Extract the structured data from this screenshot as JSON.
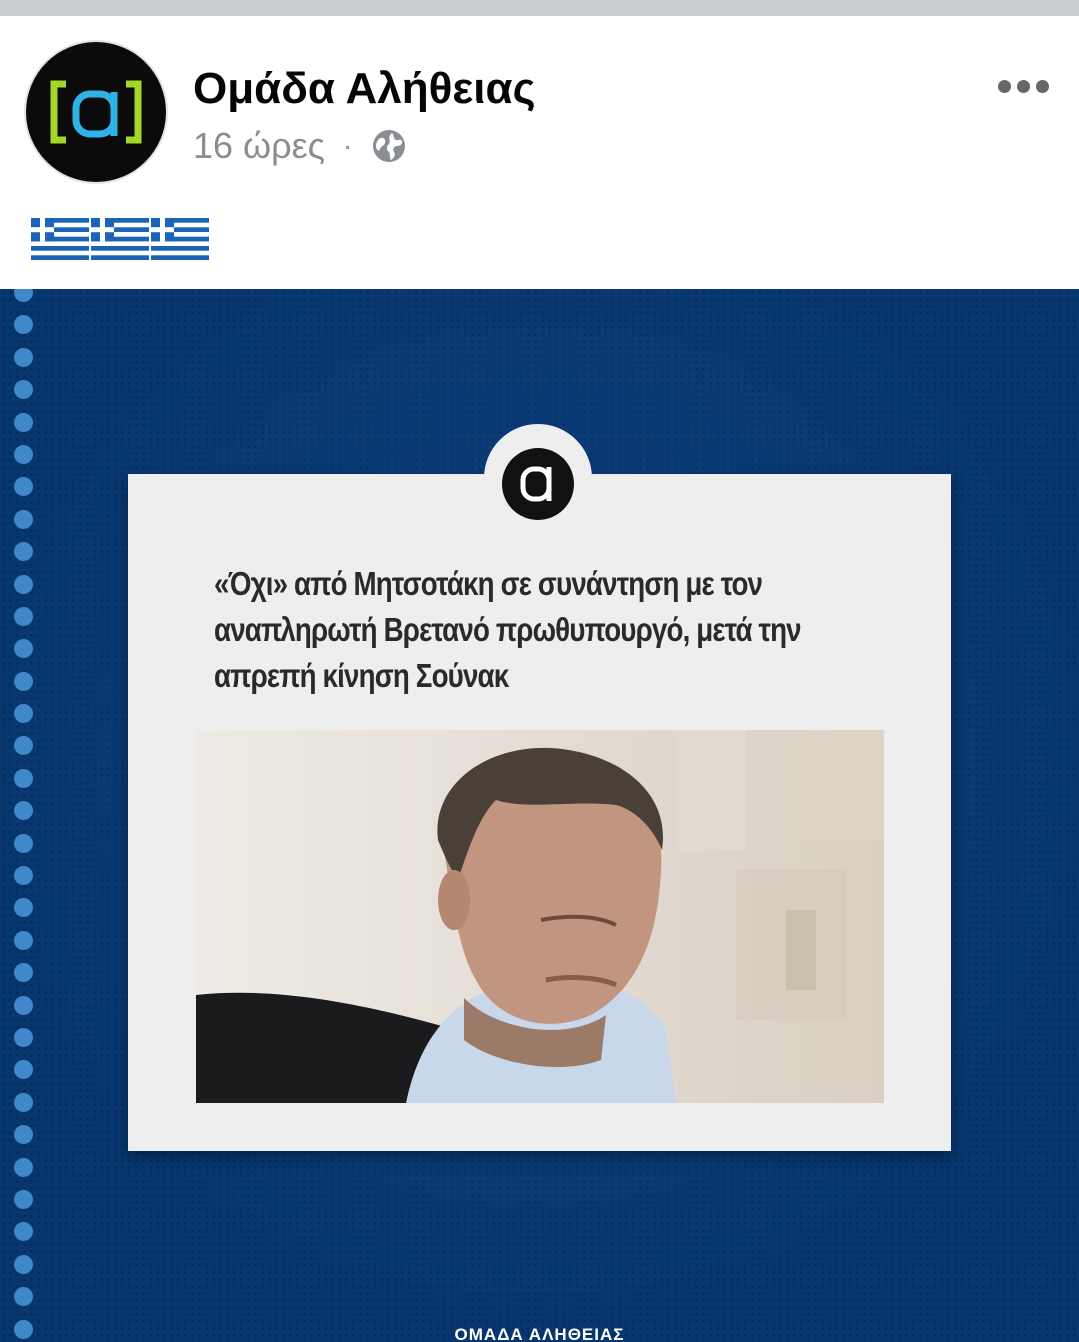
{
  "post": {
    "page_name": "Ομάδα Αλήθειας",
    "time": "16 ώρες",
    "separator": "·",
    "privacy_icon": "globe-icon",
    "more_icon": "more-horizontal-icon",
    "caption_emoji": "🇬🇷🇬🇷🇬🇷",
    "avatar": {
      "logo_text": "[α]",
      "bracket_color": "#a7d62b",
      "letter_color": "#2fb2e6"
    }
  },
  "image": {
    "card_logo_text": "α",
    "headline": "«Όχι» από Μητσοτάκη σε συνάντηση με τον αναπληρωτή Βρετανό πρωθυπουργό, μετά την απρεπή κίνηση Σούνακ",
    "headline_lines": [
      "«Όχι» από Μητσοτάκη σε συνάντηση με τον",
      "αναπληρωτή Βρετανό πρωθυπουργό, μετά την",
      "απρεπή κίνηση Σούνακ"
    ],
    "footer_brand": "ΟΜΑΔΑ ΑΛΗΘΕΙΑΣ",
    "background_color": "#083770",
    "dot_color": "#3f88c9"
  }
}
